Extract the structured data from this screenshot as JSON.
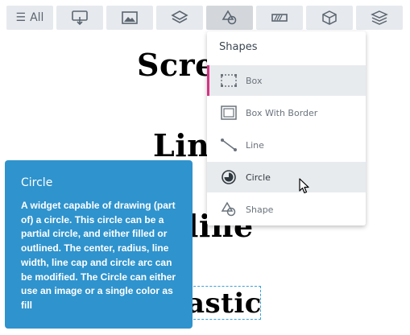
{
  "toolbar": {
    "all_label": "All",
    "buttons": [
      {
        "icon": "screen-icon"
      },
      {
        "icon": "image-icon"
      },
      {
        "icon": "layers-icon"
      },
      {
        "icon": "shapes-icon",
        "active": true
      },
      {
        "icon": "progress-bar-icon"
      },
      {
        "icon": "cube-icon"
      },
      {
        "icon": "stack-icon"
      }
    ]
  },
  "canvas": {
    "texts": [
      "Scre",
      "Lin",
      "line",
      "astic"
    ]
  },
  "dropdown": {
    "title": "Shapes",
    "items": [
      {
        "label": "Box",
        "icon": "box-icon"
      },
      {
        "label": "Box With Border",
        "icon": "box-with-border-icon"
      },
      {
        "label": "Line",
        "icon": "line-icon"
      },
      {
        "label": "Circle",
        "icon": "circle-icon"
      },
      {
        "label": "Shape",
        "icon": "shape-icon"
      }
    ]
  },
  "tooltip": {
    "title": "Circle",
    "body": "A widget capable of drawing (part of) a circle. This circle can be a partial circle, and either filled or outlined. The center, radius, line width, line cap and circle arc can be modified. The Circle can either use an image or a single color as fill"
  },
  "colors": {
    "accent": "#2f93cd",
    "selection_marker": "#d63384",
    "toolbar_button": "#e6e9ed"
  }
}
